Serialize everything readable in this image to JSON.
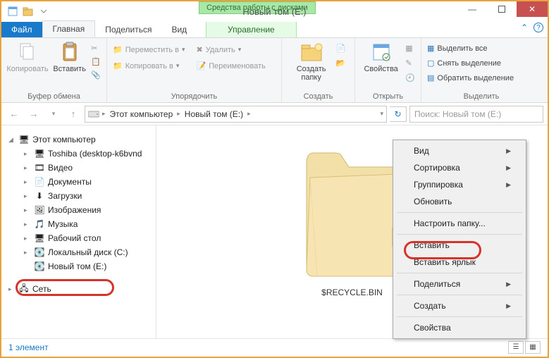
{
  "window": {
    "title": "Новый том (E:)",
    "disktools": "Средства работы с дисками"
  },
  "tabs": {
    "file": "Файл",
    "home": "Главная",
    "share": "Поделиться",
    "view": "Вид",
    "manage": "Управление"
  },
  "ribbon": {
    "clipboard": {
      "label": "Буфер обмена",
      "copy": "Копировать",
      "paste": "Вставить"
    },
    "organize": {
      "label": "Упорядочить",
      "moveto": "Переместить в",
      "copyto": "Копировать в",
      "delete": "Удалить",
      "rename": "Переименовать"
    },
    "new": {
      "label": "Создать",
      "newfolder": "Создать\nпапку"
    },
    "open": {
      "label": "Открыть",
      "properties": "Свойства"
    },
    "select": {
      "label": "Выделить",
      "selectall": "Выделить все",
      "selectnone": "Снять выделение",
      "invert": "Обратить выделение"
    }
  },
  "breadcrumb": {
    "root": "Этот компьютер",
    "current": "Новый том (E:)"
  },
  "search": {
    "placeholder": "Поиск: Новый том (E:)"
  },
  "tree": {
    "thispc": "Этот компьютер",
    "items": [
      "Toshiba (desktop-k6bvnd",
      "Видео",
      "Документы",
      "Загрузки",
      "Изображения",
      "Музыка",
      "Рабочий стол",
      "Локальный диск (C:)",
      "Новый том (E:)"
    ],
    "network": "Сеть"
  },
  "content": {
    "item": "$RECYCLE.BIN"
  },
  "context": {
    "view": "Вид",
    "sort": "Сортировка",
    "group": "Группировка",
    "refresh": "Обновить",
    "customize": "Настроить папку...",
    "paste": "Вставить",
    "pasteshortcut": "Вставить ярлык",
    "share": "Поделиться",
    "new": "Создать",
    "properties": "Свойства"
  },
  "status": {
    "count": "1 элемент"
  }
}
